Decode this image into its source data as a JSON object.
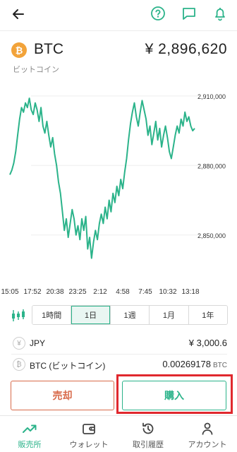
{
  "colors": {
    "accent": "#2bb38a",
    "sell": "#d86a4a",
    "highlight": "#e0282e",
    "bitcoin": "#f2a33a"
  },
  "header": {
    "icons": [
      "back-arrow-icon",
      "help-icon",
      "chat-icon",
      "bell-icon"
    ]
  },
  "asset": {
    "symbol": "BTC",
    "price": "¥ 2,896,620",
    "name": "ビットコイン",
    "coin_glyph": "₿"
  },
  "chart_data": {
    "type": "line",
    "y_ticks": [
      "2,910,000",
      "2,880,000",
      "2,850,000"
    ],
    "y_tick_values": [
      2910000,
      2880000,
      2850000
    ],
    "ylim": [
      2835000,
      2913000
    ],
    "x_ticks": [
      "15:05",
      "17:52",
      "20:38",
      "23:25",
      "2:12",
      "4:58",
      "7:45",
      "10:32",
      "13:18"
    ],
    "grid": true,
    "series": [
      {
        "values": [
          2876000,
          2878000,
          2881000,
          2886000,
          2893000,
          2900000,
          2905000,
          2903000,
          2907000,
          2905000,
          2909000,
          2904000,
          2902000,
          2907000,
          2904000,
          2899000,
          2905000,
          2897000,
          2894000,
          2899000,
          2893000,
          2888000,
          2892000,
          2885000,
          2880000,
          2873000,
          2868000,
          2860000,
          2852000,
          2857000,
          2849000,
          2855000,
          2861000,
          2857000,
          2850000,
          2854000,
          2848000,
          2857000,
          2852000,
          2858000,
          2844000,
          2849000,
          2840000,
          2847000,
          2852000,
          2848000,
          2855000,
          2859000,
          2855000,
          2862000,
          2857000,
          2865000,
          2860000,
          2868000,
          2864000,
          2871000,
          2867000,
          2874000,
          2870000,
          2877000,
          2883000,
          2891000,
          2898000,
          2903000,
          2907000,
          2901000,
          2897000,
          2903000,
          2908000,
          2904000,
          2900000,
          2893000,
          2897000,
          2889000,
          2894000,
          2899000,
          2891000,
          2896000,
          2888000,
          2893000,
          2897000,
          2892000,
          2886000,
          2883000,
          2888000,
          2893000,
          2897000,
          2894000,
          2900000,
          2897000,
          2903000,
          2899000,
          2901000,
          2897000,
          2895000,
          2896000
        ]
      }
    ]
  },
  "timeframes": {
    "chart_type_icon": "candlestick-icon",
    "options": [
      "1時間",
      "1日",
      "1週",
      "1月",
      "1年"
    ],
    "selected": "1日"
  },
  "balances": [
    {
      "icon": "yen-coin-icon",
      "glyph": "¥",
      "label": "JPY",
      "value": "¥ 3,000.6",
      "unit": ""
    },
    {
      "icon": "bitcoin-coin-icon",
      "glyph": "₿",
      "label": "BTC (ビットコイン)",
      "value": "0.00269178",
      "unit": "BTC"
    }
  ],
  "actions": {
    "sell_label": "売却",
    "buy_label": "購入"
  },
  "nav": [
    {
      "label": "販売所",
      "icon": "trend-up-icon",
      "active": true
    },
    {
      "label": "ウォレット",
      "icon": "wallet-icon",
      "active": false
    },
    {
      "label": "取引履歴",
      "icon": "history-icon",
      "active": false
    },
    {
      "label": "アカウント",
      "icon": "account-icon",
      "active": false
    }
  ]
}
